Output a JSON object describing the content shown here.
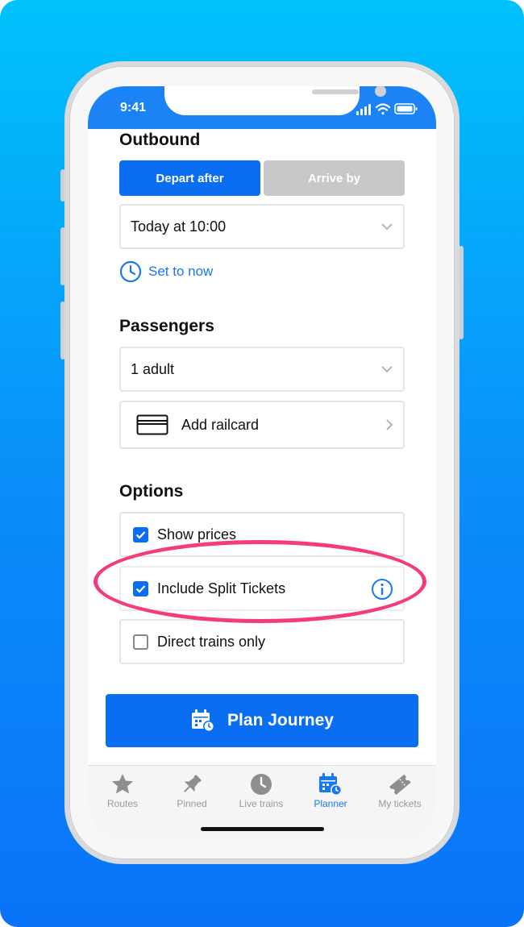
{
  "status_bar": {
    "time": "9:41"
  },
  "outbound": {
    "title": "Outbound",
    "depart_after_label": "Depart after",
    "arrive_by_label": "Arrive by",
    "datetime_value": "Today at 10:00",
    "set_to_now_label": "Set to now"
  },
  "passengers": {
    "title": "Passengers",
    "count_value": "1 adult",
    "add_railcard_label": "Add railcard"
  },
  "options": {
    "title": "Options",
    "items": [
      {
        "label": "Show prices",
        "checked": true
      },
      {
        "label": "Include Split Tickets",
        "checked": true
      },
      {
        "label": "Direct trains only",
        "checked": false
      }
    ]
  },
  "plan_button": {
    "label": "Plan Journey"
  },
  "tabs": [
    {
      "label": "Routes",
      "icon": "star-icon"
    },
    {
      "label": "Pinned",
      "icon": "pin-icon"
    },
    {
      "label": "Live trains",
      "icon": "clock-icon"
    },
    {
      "label": "Planner",
      "icon": "calendar-icon",
      "active": true
    },
    {
      "label": "My tickets",
      "icon": "ticket-icon"
    }
  ],
  "colors": {
    "accent": "#0a6ef3",
    "highlight": "#f53b78",
    "inactive_segment": "#c8c8cb",
    "background_top": "#00c2fb",
    "background_bottom": "#0a73f8"
  }
}
